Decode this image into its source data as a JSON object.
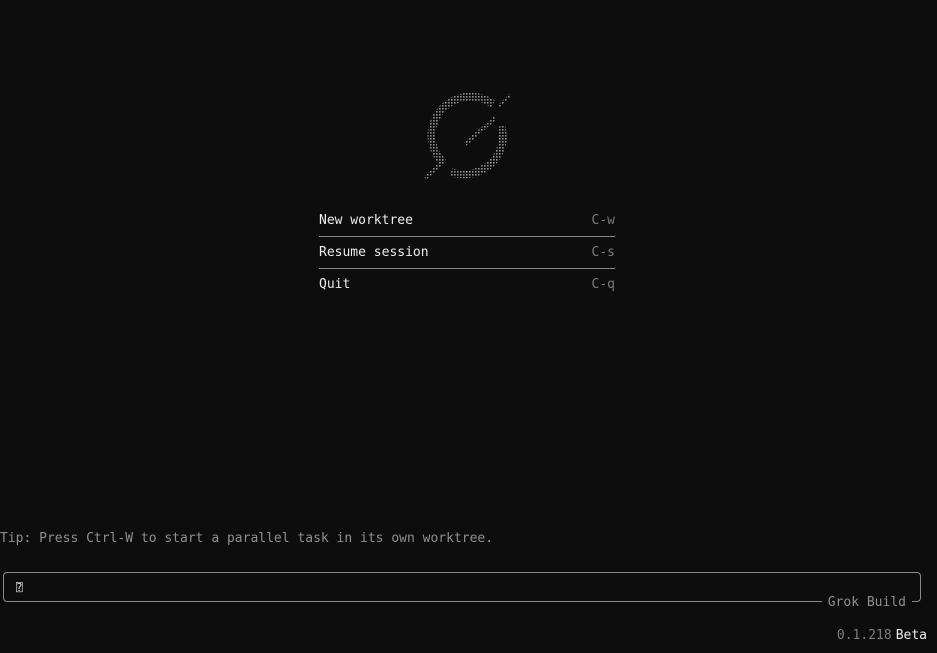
{
  "logo": {
    "icon": "grok-logo-icon",
    "color": "#8f8f8f"
  },
  "menu": {
    "items": [
      {
        "label": "New worktree",
        "shortcut": "C-w"
      },
      {
        "label": "Resume session",
        "shortcut": "C-s"
      },
      {
        "label": "Quit",
        "shortcut": "C-q"
      }
    ]
  },
  "tip": "Tip: Press Ctrl-W to start a parallel task in its own worktree.",
  "prompt": {
    "cursor": "⍰",
    "box_label": "Grok Build"
  },
  "footer": {
    "version": "0.1.218",
    "tag": "Beta"
  },
  "colors": {
    "background": "#0d0d0d",
    "text": "#ececec",
    "muted": "#8f8f8f",
    "border": "#8a8a8a"
  }
}
